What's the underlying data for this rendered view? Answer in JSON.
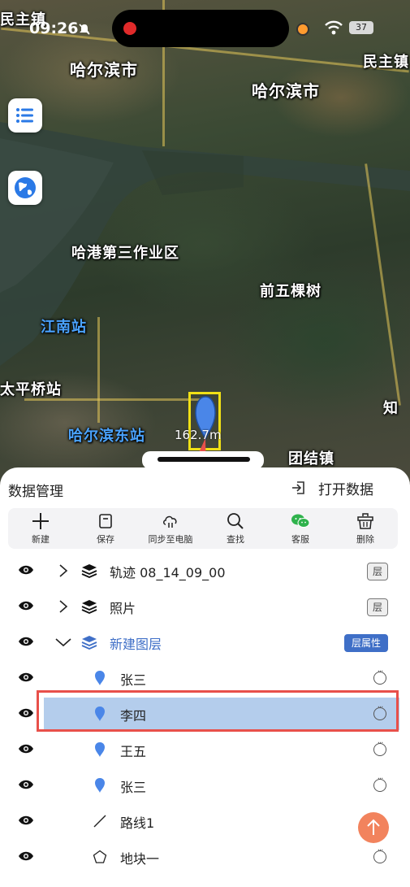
{
  "status_bar": {
    "time": "09:26",
    "battery": "37"
  },
  "map": {
    "labels": [
      {
        "text": "民主镇",
        "key": "a"
      },
      {
        "text": "哈尔滨市",
        "key": "b"
      },
      {
        "text": "哈尔滨市",
        "key": "c"
      },
      {
        "text": "民主镇",
        "key": "d"
      },
      {
        "text": "哈港第三作业区",
        "key": "e"
      },
      {
        "text": "前五棵树",
        "key": "f"
      },
      {
        "text": "江南站",
        "key": "g"
      },
      {
        "text": "太平桥站",
        "key": "h"
      },
      {
        "text": "哈尔滨东站",
        "key": "i"
      },
      {
        "text": "团结镇",
        "key": "j"
      },
      {
        "text": "知",
        "key": "k"
      }
    ],
    "scale_text": "162.7m",
    "colors": {
      "selection": "#f0e016",
      "pin": "#4a86e8",
      "annotation_arrow": "#e8504a"
    }
  },
  "panel": {
    "title": "数据管理",
    "open_data_label": "打开数据",
    "toolbar": [
      {
        "label": "新建",
        "icon": "plus-icon"
      },
      {
        "label": "保存",
        "icon": "save-icon"
      },
      {
        "label": "同步至电脑",
        "icon": "sync-icon"
      },
      {
        "label": "查找",
        "icon": "search-icon"
      },
      {
        "label": "客服",
        "icon": "wechat-icon"
      },
      {
        "label": "删除",
        "icon": "trash-icon"
      }
    ],
    "layers": [
      {
        "label": "轨迹 08_14_09_00",
        "type": "layer",
        "badge": "层"
      },
      {
        "label": "照片",
        "type": "layer",
        "badge": "层"
      },
      {
        "label": "新建图层",
        "type": "layer-expanded",
        "badge": "层属性"
      },
      {
        "label": "张三",
        "type": "point"
      },
      {
        "label": "李四",
        "type": "point",
        "selected": true
      },
      {
        "label": "王五",
        "type": "point"
      },
      {
        "label": "张三",
        "type": "point"
      },
      {
        "label": "路线1",
        "type": "line"
      },
      {
        "label": "地块一",
        "type": "polygon"
      }
    ]
  }
}
